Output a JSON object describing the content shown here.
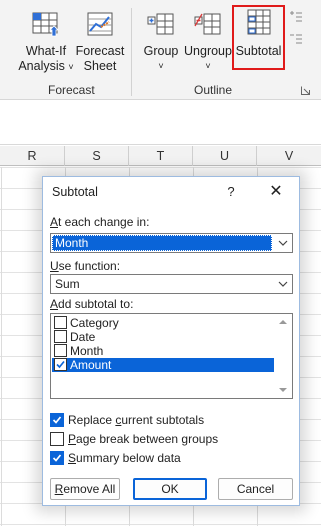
{
  "ribbon": {
    "whatif_line1": "What-If",
    "whatif_line2": "Analysis",
    "forecast_line1": "Forecast",
    "forecast_line2": "Sheet",
    "group_label": "Group",
    "ungroup_label": "Ungroup",
    "subtotal_label": "Subtotal",
    "forecast_group": "Forecast",
    "outline_group": "Outline",
    "dropdown_glyph": "˅"
  },
  "columns": [
    "R",
    "S",
    "T",
    "U",
    "V"
  ],
  "dialog": {
    "title": "Subtotal",
    "help": "?",
    "close": "✕",
    "change_label_a": "A",
    "change_label_rest": "t each change in:",
    "change_value": "Month",
    "function_label_a": "U",
    "function_label_rest": "se function:",
    "function_value": "Sum",
    "add_label_a": "A",
    "add_label_rest": "dd subtotal to:",
    "fields": [
      {
        "label": "Category",
        "checked": false
      },
      {
        "label": "Date",
        "checked": false
      },
      {
        "label": "Month",
        "checked": false
      },
      {
        "label": "Amount",
        "checked": true
      }
    ],
    "opt_replace_pre": "Replace ",
    "opt_replace_u": "c",
    "opt_replace_post": "urrent subtotals",
    "opt_page_u": "P",
    "opt_page_post": "age break between groups",
    "opt_summary_u": "S",
    "opt_summary_post": "ummary below data",
    "options_checked": [
      true,
      false,
      true
    ],
    "remove_all_pre": "",
    "remove_all_u": "R",
    "remove_all_post": "emove All",
    "ok": "OK",
    "cancel": "Cancel"
  },
  "colors": {
    "accent": "#0a64d8",
    "highlight_box": "#e01a1a"
  }
}
